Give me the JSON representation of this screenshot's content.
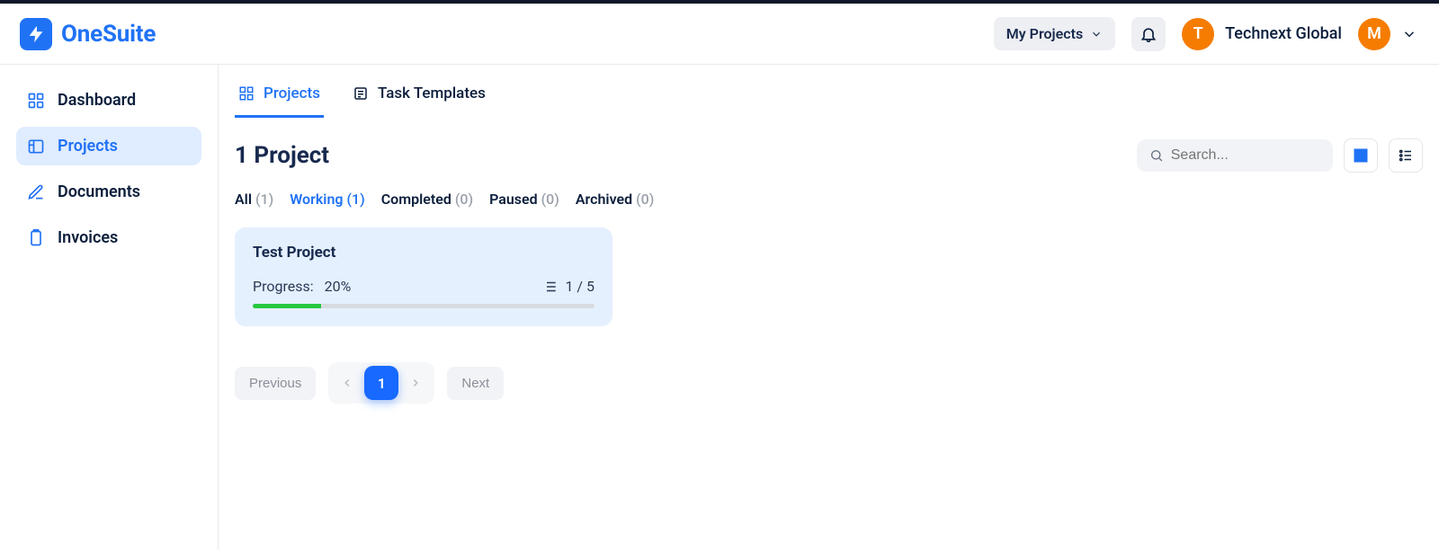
{
  "brand": "OneSuite",
  "header": {
    "my_projects_label": "My Projects",
    "org_initial": "T",
    "org_name": "Technext Global",
    "user_initial": "M"
  },
  "sidebar": {
    "items": [
      {
        "label": "Dashboard"
      },
      {
        "label": "Projects"
      },
      {
        "label": "Documents"
      },
      {
        "label": "Invoices"
      }
    ]
  },
  "tabs": {
    "projects": "Projects",
    "task_templates": "Task Templates"
  },
  "heading": "1 Project",
  "search": {
    "placeholder": "Search..."
  },
  "filters": [
    {
      "label": "All",
      "count": "(1)"
    },
    {
      "label": "Working",
      "count": "(1)"
    },
    {
      "label": "Completed",
      "count": "(0)"
    },
    {
      "label": "Paused",
      "count": "(0)"
    },
    {
      "label": "Archived",
      "count": "(0)"
    }
  ],
  "project": {
    "title": "Test Project",
    "progress_label": "Progress:",
    "progress_value": "20%",
    "progress_percent": 20,
    "tasks": "1 / 5"
  },
  "pager": {
    "previous": "Previous",
    "page": "1",
    "next": "Next"
  }
}
